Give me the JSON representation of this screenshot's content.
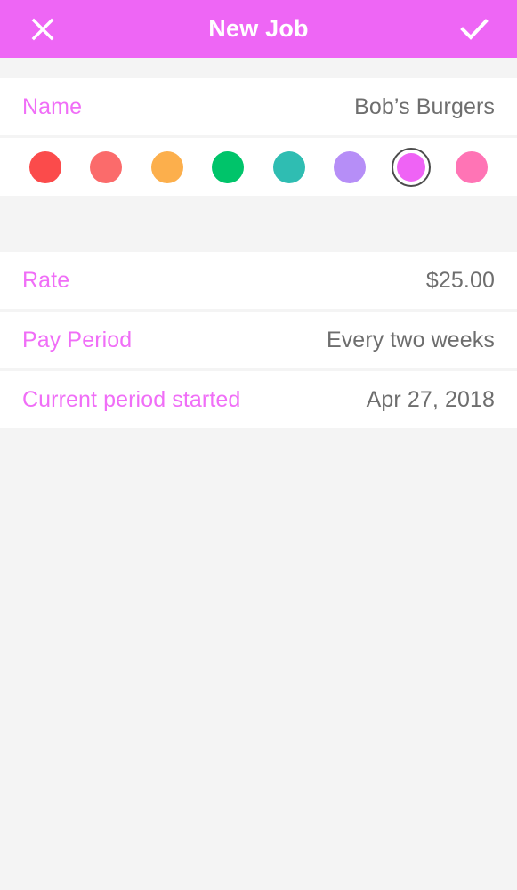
{
  "header": {
    "title": "New Job",
    "close_icon": "close-x-icon",
    "confirm_icon": "checkmark-icon",
    "background_color": "#ee66f5",
    "foreground_color": "#ffffff"
  },
  "theme": {
    "label_color": "#f06ef7",
    "value_color": "#6e6e6e",
    "page_background": "#f4f4f4",
    "row_background": "#ffffff"
  },
  "form": {
    "name": {
      "label": "Name",
      "value": "Bob’s Burgers",
      "placeholder": "Name"
    },
    "rate": {
      "label": "Rate",
      "value": "$25.00",
      "placeholder": "Rate"
    },
    "pay_period": {
      "label": "Pay Period",
      "value": "Every two weeks"
    },
    "current_period_started": {
      "label": "Current period started",
      "value": "Apr 27, 2018"
    }
  },
  "color_picker": {
    "selected_index": 6,
    "swatches": [
      {
        "name": "red",
        "color": "#fb4b4b"
      },
      {
        "name": "salmon",
        "color": "#fb6b6b"
      },
      {
        "name": "orange",
        "color": "#fcaf4c"
      },
      {
        "name": "green",
        "color": "#00c46a"
      },
      {
        "name": "teal",
        "color": "#2fbdb2"
      },
      {
        "name": "lavender",
        "color": "#b68ef7"
      },
      {
        "name": "magenta",
        "color": "#ef63f5"
      },
      {
        "name": "pink",
        "color": "#ff74b5"
      }
    ]
  }
}
